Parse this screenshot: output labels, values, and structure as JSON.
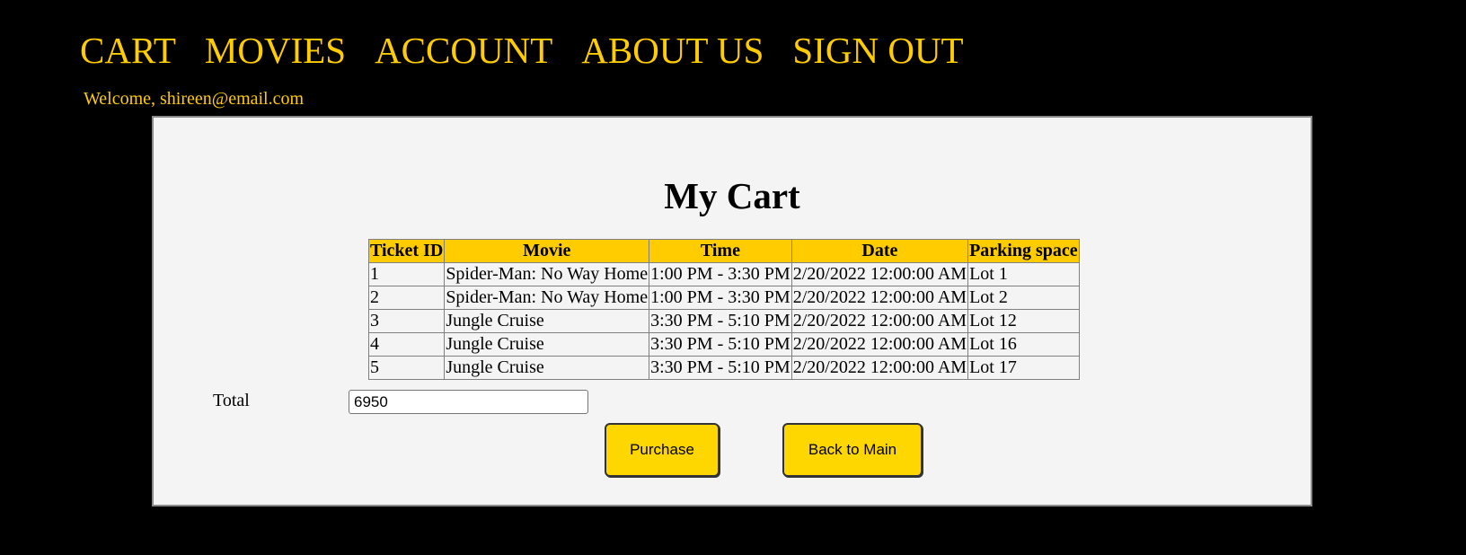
{
  "nav": {
    "items": [
      {
        "label": "CART"
      },
      {
        "label": "MOVIES"
      },
      {
        "label": "ACCOUNT"
      },
      {
        "label": "ABOUT US"
      },
      {
        "label": "SIGN OUT"
      }
    ]
  },
  "welcome": "Welcome, shireen@email.com",
  "cart": {
    "title": "My Cart",
    "headers": [
      "Ticket ID",
      "Movie",
      "Time",
      "Date",
      "Parking space"
    ],
    "rows": [
      [
        "1",
        "Spider-Man: No Way Home",
        "1:00 PM - 3:30 PM",
        "2/20/2022 12:00:00 AM",
        "Lot 1"
      ],
      [
        "2",
        "Spider-Man: No Way Home",
        "1:00 PM - 3:30 PM",
        "2/20/2022 12:00:00 AM",
        "Lot 2"
      ],
      [
        "3",
        "Jungle Cruise",
        "3:30 PM - 5:10 PM",
        "2/20/2022 12:00:00 AM",
        "Lot 12"
      ],
      [
        "4",
        "Jungle Cruise",
        "3:30 PM - 5:10 PM",
        "2/20/2022 12:00:00 AM",
        "Lot 16"
      ],
      [
        "5",
        "Jungle Cruise",
        "3:30 PM - 5:10 PM",
        "2/20/2022 12:00:00 AM",
        "Lot 17"
      ]
    ],
    "total_label": "Total",
    "total_value": "6950",
    "purchase_label": "Purchase",
    "back_label": "Back to Main"
  },
  "colors": {
    "background": "#000000",
    "accent": "#ffcc00",
    "panel": "#f4f4f4",
    "button": "#ffd700"
  }
}
